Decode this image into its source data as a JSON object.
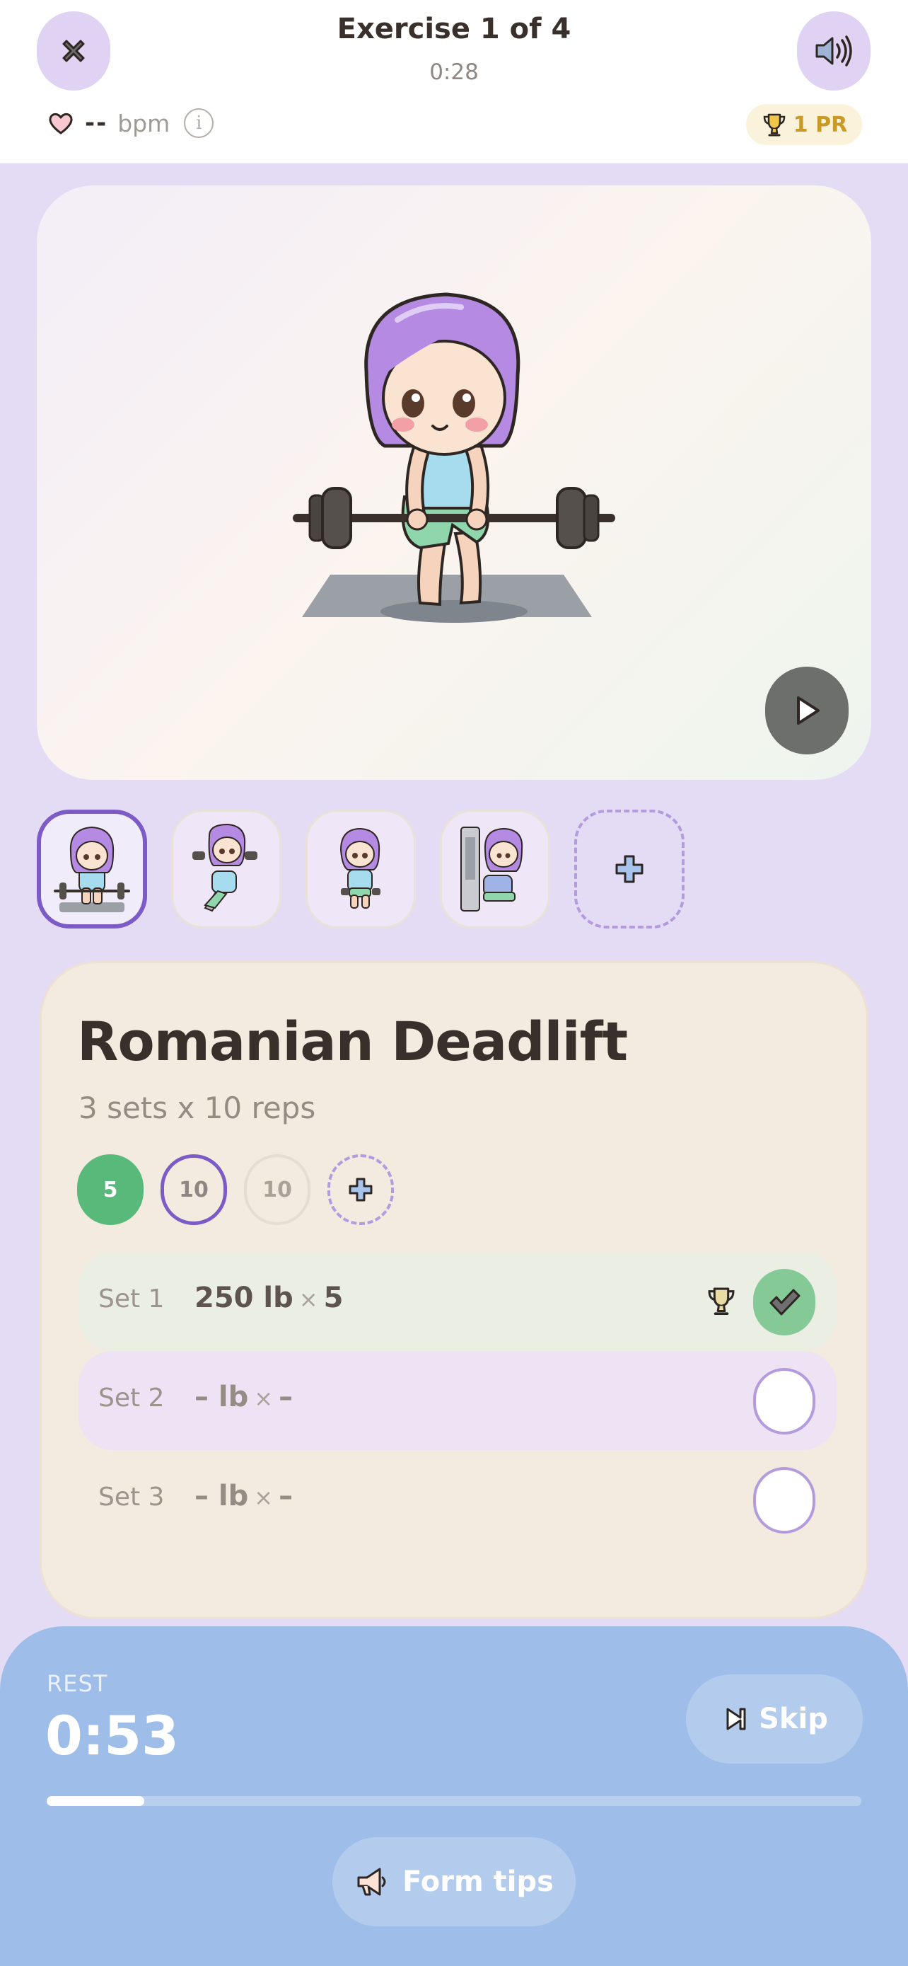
{
  "header": {
    "title": "Exercise 1 of 4",
    "timer": "0:28",
    "heart_rate": "--",
    "heart_rate_unit": "bpm",
    "info_glyph": "i",
    "pr_badge": "1 PR",
    "close_icon": "close-icon",
    "sound_icon": "speaker-icon"
  },
  "thumbnails": [
    {
      "name": "romanian-deadlift",
      "active": true
    },
    {
      "name": "incline-dumbbell-press",
      "active": false
    },
    {
      "name": "dumbbell-hold",
      "active": false
    },
    {
      "name": "cable-machine",
      "active": false
    },
    {
      "name": "add-exercise",
      "active": false
    }
  ],
  "exercise": {
    "name": "Romanian Deadlift",
    "scheme": "3 sets x 10 reps",
    "rep_chips": [
      {
        "value": "5",
        "state": "done"
      },
      {
        "value": "10",
        "state": "current"
      },
      {
        "value": "10",
        "state": "pending"
      }
    ],
    "sets": [
      {
        "label": "Set 1",
        "weight": "250 lb",
        "x": "×",
        "reps": "5",
        "completed": true,
        "pr": true
      },
      {
        "label": "Set 2",
        "weight": "– lb",
        "x": "×",
        "reps": "–",
        "completed": false,
        "pr": false
      },
      {
        "label": "Set 3",
        "weight": "– lb",
        "x": "×",
        "reps": "–",
        "completed": false,
        "pr": false
      }
    ]
  },
  "rest": {
    "label": "REST",
    "time": "0:53",
    "progress": 0.12,
    "skip_label": "Skip",
    "tips_label": "Form tips"
  },
  "colors": {
    "accent": "#7c5bc7",
    "success": "#58b97b",
    "rest_panel": "#9ebde8",
    "pr_gold": "#c99a25"
  }
}
